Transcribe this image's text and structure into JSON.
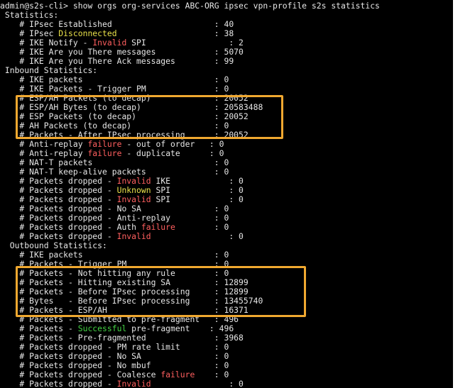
{
  "terminal": {
    "lines": [
      [
        {
          "t": "admin@s2s-cli> show orgs org-services ABC-ORG ipsec vpn-profile s2s statistics"
        }
      ],
      [
        {
          "t": " Statistics:"
        }
      ],
      [
        {
          "t": "    # IPsec Established                     : 40"
        }
      ],
      [
        {
          "t": "    # IPsec "
        },
        {
          "t": "Disconnected",
          "c": "yellow"
        },
        {
          "t": "                    : 38"
        }
      ],
      [
        {
          "t": "    # IKE Notify - "
        },
        {
          "t": "Invalid",
          "c": "red"
        },
        {
          "t": " SPI                 : 2"
        }
      ],
      [
        {
          "t": "    # IKE Are you There messages            : 5070"
        }
      ],
      [
        {
          "t": "    # IKE Are you There Ack messages        : 99"
        }
      ],
      [
        {
          "t": " Inbound Statistics:"
        }
      ],
      [
        {
          "t": "    # IKE packets                           : 0"
        }
      ],
      [
        {
          "t": "    # IKE Packets - Trigger PM              : 0"
        }
      ],
      [
        {
          "t": "    # ESP/AH Packets (to decap)             : 20052"
        }
      ],
      [
        {
          "t": "    # ESP/AH Bytes (to decap)               : 20583488"
        }
      ],
      [
        {
          "t": "    # ESP Packets (to decap)                : 20052"
        }
      ],
      [
        {
          "t": "    # AH Packets (to decap)                 : 0"
        }
      ],
      [
        {
          "t": "    # Packets - After IPsec processing      : 20052"
        }
      ],
      [
        {
          "t": "    # Anti-replay "
        },
        {
          "t": "failure",
          "c": "red"
        },
        {
          "t": " - out of order   : 0"
        }
      ],
      [
        {
          "t": "    # Anti-replay "
        },
        {
          "t": "failure",
          "c": "red"
        },
        {
          "t": " - duplicate      : 0"
        }
      ],
      [
        {
          "t": "    # NAT-T packets                         : 0"
        }
      ],
      [
        {
          "t": "    # NAT-T keep-alive packets              : 0"
        }
      ],
      [
        {
          "t": "    # Packets dropped - "
        },
        {
          "t": "Invalid",
          "c": "red"
        },
        {
          "t": " IKE            : 0"
        }
      ],
      [
        {
          "t": "    # Packets dropped - "
        },
        {
          "t": "Unknown",
          "c": "yellow"
        },
        {
          "t": " SPI            : 0"
        }
      ],
      [
        {
          "t": "    # Packets dropped - "
        },
        {
          "t": "Invalid",
          "c": "red"
        },
        {
          "t": " SPI            : 0"
        }
      ],
      [
        {
          "t": "    # Packets dropped - No SA               : 0"
        }
      ],
      [
        {
          "t": "    # Packets dropped - Anti-replay         : 0"
        }
      ],
      [
        {
          "t": "    # Packets dropped - Auth "
        },
        {
          "t": "failure",
          "c": "red"
        },
        {
          "t": "        : 0"
        }
      ],
      [
        {
          "t": "    # Packets dropped - "
        },
        {
          "t": "Invalid",
          "c": "red"
        },
        {
          "t": "                : 0"
        }
      ],
      [
        {
          "t": "  Outbound Statistics:"
        }
      ],
      [
        {
          "t": "    # IKE packets                           : 0"
        }
      ],
      [
        {
          "t": "    # Packets - Trigger PM                  : 0"
        }
      ],
      [
        {
          "t": "    # Packets - Not hitting any rule        : 0"
        }
      ],
      [
        {
          "t": "    # Packets - Hitting existing SA         : 12899"
        }
      ],
      [
        {
          "t": "    # Packets - Before IPsec processing     : 12899"
        }
      ],
      [
        {
          "t": "    # Bytes   - Before IPsec processing     : 13455740"
        }
      ],
      [
        {
          "t": "    # Packets - ESP/AH                      : 16371"
        }
      ],
      [
        {
          "t": "    # Packets - Submitted to pre-fragment   : 496"
        }
      ],
      [
        {
          "t": "    # Packets - "
        },
        {
          "t": "Successful",
          "c": "green"
        },
        {
          "t": " pre-fragment    : 496"
        }
      ],
      [
        {
          "t": "    # Packets - Pre-fragmented              : 3968"
        }
      ],
      [
        {
          "t": "    # Packets dropped - PM rate limit       : 0"
        }
      ],
      [
        {
          "t": "    # Packets dropped - No SA               : 0"
        }
      ],
      [
        {
          "t": "    # Packets dropped - No mbuf             : 0"
        }
      ],
      [
        {
          "t": "    # Packets dropped - Coalesce "
        },
        {
          "t": "failure",
          "c": "red"
        },
        {
          "t": "    : 0"
        }
      ],
      [
        {
          "t": "    # Packets dropped - "
        },
        {
          "t": "Invalid",
          "c": "red"
        },
        {
          "t": "                : 0"
        }
      ]
    ]
  },
  "colors": {
    "background": "#000000",
    "text": "#e6e6e6",
    "red": "#ff5f5f",
    "yellow": "#e8e04a",
    "green": "#44d444",
    "highlight": "#f0a830"
  }
}
